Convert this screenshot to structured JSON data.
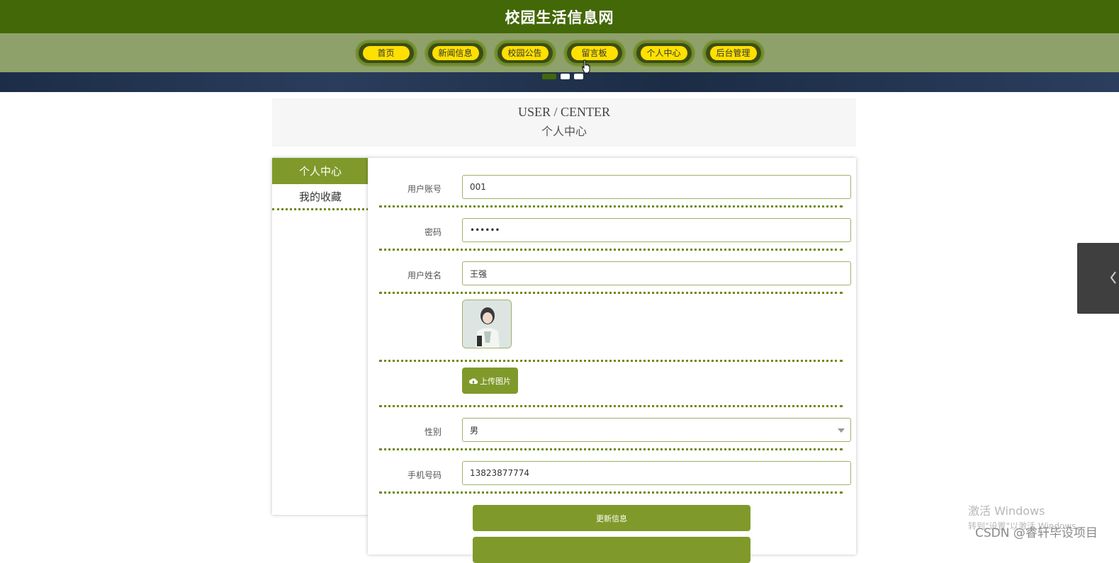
{
  "header": {
    "site_title": "校园生活信息网"
  },
  "nav": {
    "items": [
      {
        "label": "首页"
      },
      {
        "label": "新闻信息"
      },
      {
        "label": "校园公告"
      },
      {
        "label": "留言板"
      },
      {
        "label": "个人中心"
      },
      {
        "label": "后台管理"
      }
    ],
    "active_color": "#ffe000"
  },
  "title_block": {
    "en": "USER / CENTER",
    "cn": "个人中心"
  },
  "side_menu": {
    "items": [
      {
        "label": "个人中心",
        "active": true
      },
      {
        "label": "我的收藏",
        "active": false
      }
    ]
  },
  "form": {
    "account": {
      "label": "用户账号",
      "value": "001"
    },
    "password": {
      "label": "密码",
      "value": "••••••"
    },
    "name": {
      "label": "用户姓名",
      "value": "王强"
    },
    "upload_label": "上传图片",
    "gender": {
      "label": "性别",
      "value": "男"
    },
    "phone": {
      "label": "手机号码",
      "value": "13823877774"
    },
    "update_label": "更新信息"
  },
  "watermark": {
    "windows_line1": "激活 Windows",
    "windows_line2": "转到\"设置\"以激活 Windows。",
    "csdn": "CSDN @睿轩毕设项目"
  },
  "colors": {
    "header": "#436807",
    "nav_bg": "#8ea16a",
    "accent": "#7f9a2a"
  }
}
